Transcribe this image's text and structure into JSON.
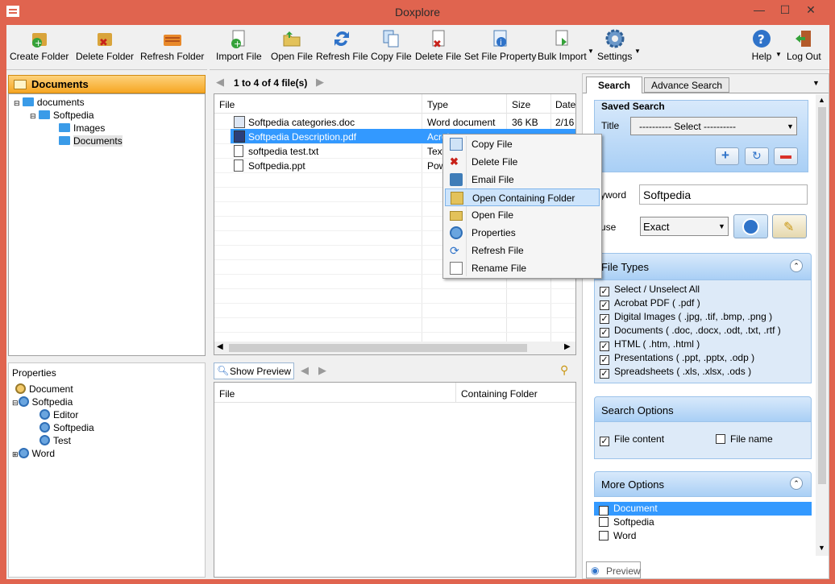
{
  "window": {
    "title": "Doxplore",
    "minimize": "—",
    "maximize": "☐",
    "close": "✕"
  },
  "left_toolbar": [
    {
      "label": "Create Folder",
      "icon": "create-folder-icon"
    },
    {
      "label": "Delete Folder",
      "icon": "delete-folder-icon"
    },
    {
      "label": "Refresh Folder",
      "icon": "refresh-folder-icon"
    }
  ],
  "main_toolbar": [
    {
      "label": "Import File",
      "icon": "import-file-icon"
    },
    {
      "label": "Open File",
      "icon": "open-file-icon"
    },
    {
      "label": "Refresh File",
      "icon": "refresh-file-icon"
    },
    {
      "label": "Copy File",
      "icon": "copy-file-icon"
    },
    {
      "label": "Delete File",
      "icon": "delete-file-icon"
    },
    {
      "label": "Set File Property",
      "icon": "set-file-property-icon"
    },
    {
      "label": "Bulk Import",
      "icon": "bulk-import-icon"
    },
    {
      "label": "Settings",
      "icon": "settings-icon"
    },
    {
      "label": "Help",
      "icon": "help-icon"
    },
    {
      "label": "Log Out",
      "icon": "logout-icon"
    }
  ],
  "folders": {
    "header": "Documents",
    "tree": [
      "documents",
      "Softpedia",
      "Images",
      "Documents"
    ]
  },
  "properties": {
    "header": "Properties",
    "tree": [
      "Document",
      "Softpedia",
      "Editor",
      "Softpedia",
      "Test",
      "Word"
    ]
  },
  "file_list": {
    "pager": "1 to 4 of 4 file(s)",
    "columns": [
      "File",
      "Type",
      "Size",
      "Date"
    ],
    "rows": [
      {
        "name": "Softpedia categories.doc",
        "type": "Word document",
        "size": "36 KB",
        "date": "2/16"
      },
      {
        "name": "Softpedia Description.pdf",
        "type": "Acrobat",
        "size": "",
        "date": ""
      },
      {
        "name": "softpedia test.txt",
        "type": "Text",
        "size": "",
        "date": ""
      },
      {
        "name": "Softpedia.ppt",
        "type": "Pow",
        "size": "",
        "date": ""
      }
    ]
  },
  "context_menu": [
    "Copy File",
    "Delete File",
    "Email File",
    "Open Containing Folder",
    "Open File",
    "Properties",
    "Refresh File",
    "Rename File"
  ],
  "preview": {
    "show_preview": "Show Preview",
    "columns": [
      "File",
      "Containing Folder"
    ]
  },
  "search": {
    "tabs": [
      "Search",
      "Advance Search"
    ],
    "saved_search": "Saved Search",
    "title_label": "Title",
    "title_select": "---------- Select ----------",
    "keyword_label": "yword",
    "keyword_value": "Softpedia",
    "clause_label": "use",
    "clause_value": "Exact",
    "file_types_header": "File Types",
    "file_types": [
      "Select / Unselect  All",
      "Acrobat PDF ( .pdf )",
      "Digital Images ( .jpg, .tif, .bmp, .png )",
      "Documents ( .doc, .docx, .odt, .txt, .rtf )",
      "HTML ( .htm, .html )",
      "Presentations ( .ppt, .pptx, .odp )",
      "Spreadsheets ( .xls, .xlsx, .ods )"
    ],
    "search_options_header": "Search Options",
    "file_content": "File content",
    "file_name": "File name",
    "more_options_header": "More Options",
    "more_options": [
      "Document",
      "Softpedia",
      "Word"
    ],
    "preview_tab": "Preview"
  },
  "colors": {
    "window": "#e0644f",
    "accent": "#3399ff",
    "header": "#f6a623"
  }
}
